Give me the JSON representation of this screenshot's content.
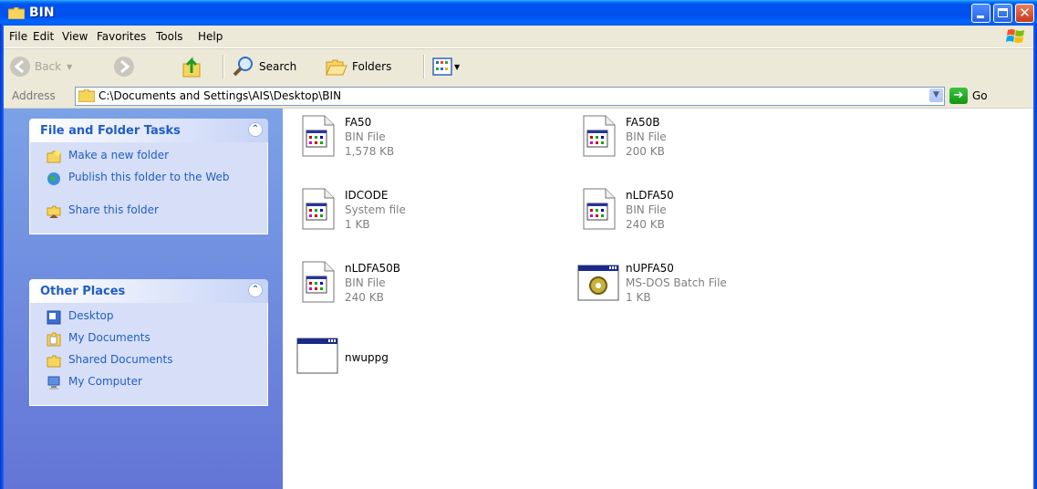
{
  "window": {
    "title": "BIN"
  },
  "menu": [
    "File",
    "Edit",
    "View",
    "Favorites",
    "Tools",
    "Help"
  ],
  "toolbar": {
    "back": "Back",
    "search": "Search",
    "folders": "Folders"
  },
  "address": {
    "label": "Address",
    "path": "C:\\Documents and Settings\\AIS\\Desktop\\BIN",
    "go": "Go"
  },
  "tasks": {
    "title": "File and Folder Tasks",
    "items": [
      "Make a new folder",
      "Publish this folder to the Web",
      "Share this folder"
    ]
  },
  "places": {
    "title": "Other Places",
    "items": [
      "Desktop",
      "My Documents",
      "Shared Documents",
      "My Computer"
    ]
  },
  "files": [
    {
      "name": "FA50",
      "type": "BIN File",
      "size": "1,578 KB",
      "icon": "bin-file-icon"
    },
    {
      "name": "FA50B",
      "type": "BIN File",
      "size": "200 KB",
      "icon": "bin-file-icon"
    },
    {
      "name": "IDCODE",
      "type": "System file",
      "size": "1 KB",
      "icon": "system-file-icon"
    },
    {
      "name": "nLDFA50",
      "type": "BIN File",
      "size": "240 KB",
      "icon": "bin-file-icon"
    },
    {
      "name": "nLDFA50B",
      "type": "BIN File",
      "size": "240 KB",
      "icon": "bin-file-icon"
    },
    {
      "name": "nUPFA50",
      "type": "MS-DOS Batch File",
      "size": "1 KB",
      "icon": "batch-file-icon"
    },
    {
      "name": "nwuppg",
      "type": "",
      "size": "",
      "icon": "application-window-icon"
    }
  ]
}
